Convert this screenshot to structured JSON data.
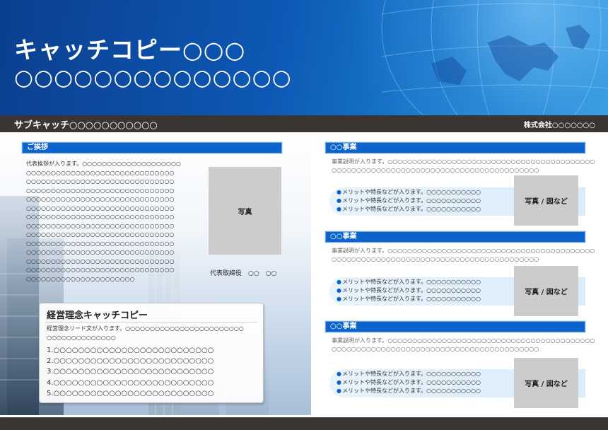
{
  "header": {
    "title": "キャッチコピー○○○",
    "subtitle": "○○○○○○○○○○○○○○",
    "subcatch": "サブキャッチ○○○○○○○○○○○",
    "company": "株式会社○○○○○○○"
  },
  "greeting": {
    "heading": "ご挨拶",
    "lines": [
      "代表挨拶が入ります。○○○○○○○○○○○○○○○○○○○○",
      "○○○○○○○○○○○○○○○○○○○○○○○○○○○○○○",
      "○○○○○○○○○○○○○○○○○○○○○○○○○○○○○○",
      "○○○○○○○○○○○○○○○○○○○○○○○○○○○○○○",
      "○○○○○○○○○○○○○○○○○○○○○○○○○○○○○○",
      "○○○○○○○○○○○○○○○○○○○○○○○○○○○○○○",
      "○○○○○○○○○○○○○○○○○○○○○○○○○○○○○○",
      "○○○○○○○○○○○○○○○○○○○○○○○○○○○○○○",
      "○○○○○○○○○○○○○○○○○○○○○○○○○○○○○○",
      "○○○○○○○○○○○○○○○○○○○○○○○○○○○○○○",
      "○○○○○○○○○○○○○○○○○○○○○○○○○○○○○○",
      "○○○○○○○○○○○○○○○○○○○○○○○○○○○○○○",
      "○○○○○○○○○○○○○○○○○○○○○○○○○○○○○○",
      "○○○○○○○○○○○○○○○○○○○○○○"
    ],
    "photo_label": "写真",
    "representative": "代表取締役　○○　○○"
  },
  "philosophy": {
    "title": "経営理念キャッチコピー",
    "lead": [
      "経営理念リード文が入ります。○○○○○○○○○○○○○○○○○○○○○○○○",
      "○○○○○○○○○○○○○○"
    ],
    "items": [
      "1.○○○○○○○○○○○○○○○○○○○○○○○○○○",
      "2.○○○○○○○○○○○○○○○○○○○○○○○○○○",
      "3.○○○○○○○○○○○○○○○○○○○○○○○○○○",
      "4.○○○○○○○○○○○○○○○○○○○○○○○○○○",
      "5.○○○○○○○○○○○○○○○○○○○○○○○○○○"
    ]
  },
  "businesses": [
    {
      "heading": "○○事業",
      "desc": [
        "事業説明が入ります。○○○○○○○○○○○○○○○○○○○○○○○○○○○○○○○○○○○○○○○○○○",
        "○○○○○○○○○○○○○○○○○○○○○○○○○○○○○○○○○○○○○○○○○○"
      ],
      "bullets": [
        "メリットや特長などが入ります。○○○○○○○○○○○",
        "メリットや特長などが入ります。○○○○○○○○○○○",
        "メリットや特長などが入ります。○○○○○○○○○○○"
      ],
      "photo_label": "写真 / 図など"
    },
    {
      "heading": "○○事業",
      "desc": [
        "事業説明が入ります。○○○○○○○○○○○○○○○○○○○○○○○○○○○○○○○○○○○○○○○○○○",
        "○○○○○○○○○○○○○○○○○○○○○○○○○○○○○○○○○○○○○○○○○○"
      ],
      "bullets": [
        "メリットや特長などが入ります。○○○○○○○○○○○",
        "メリットや特長などが入ります。○○○○○○○○○○○",
        "メリットや特長などが入ります。○○○○○○○○○○○"
      ],
      "photo_label": "写真 / 図など"
    },
    {
      "heading": "○○事業",
      "desc": [
        "事業説明が入ります。○○○○○○○○○○○○○○○○○○○○○○○○○○○○○○○○○○○○○○○○○○",
        "○○○○○○○○○○○○○○○○○○○○○○○○○○○○○○○○○○○○○○○○○○"
      ],
      "bullets": [
        "メリットや特長などが入ります。○○○○○○○○○○○",
        "メリットや特長などが入ります。○○○○○○○○○○○",
        "メリットや特長などが入ります。○○○○○○○○○○○"
      ],
      "photo_label": "写真 / 図など"
    }
  ]
}
